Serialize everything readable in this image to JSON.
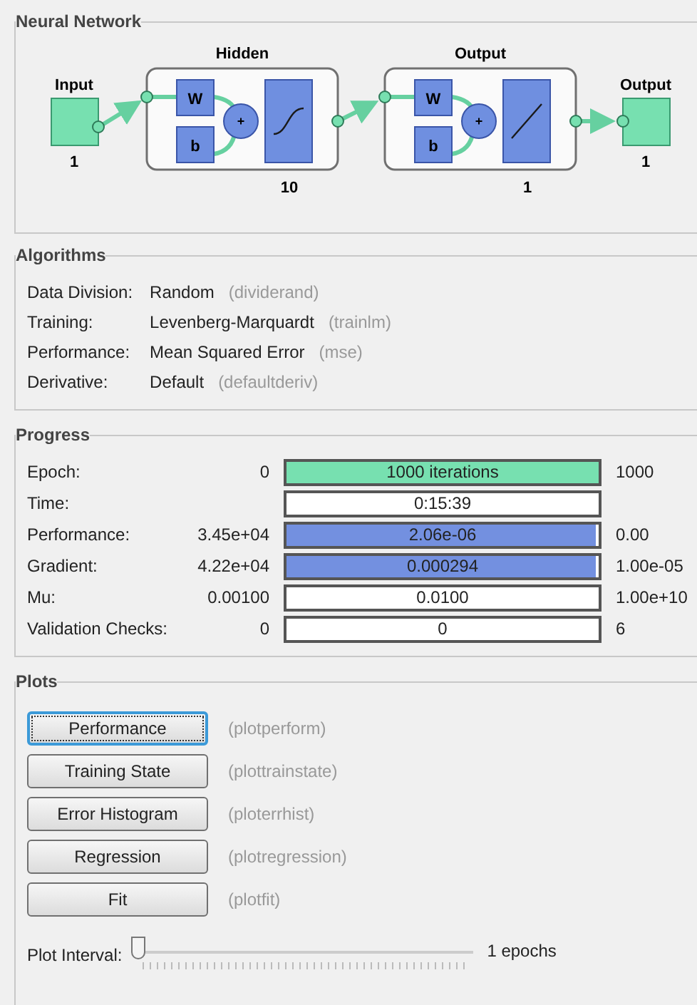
{
  "network": {
    "title": "Neural Network",
    "input": {
      "label": "Input",
      "size": "1"
    },
    "layers": [
      {
        "label": "Hidden",
        "weight": "W",
        "bias": "b",
        "sum": "+",
        "kind": "sigmoid",
        "size": "10"
      },
      {
        "label": "Output",
        "weight": "W",
        "bias": "b",
        "sum": "+",
        "kind": "linear",
        "size": "1"
      }
    ],
    "output": {
      "label": "Output",
      "size": "1"
    }
  },
  "algorithms": {
    "title": "Algorithms",
    "rows": [
      {
        "label": "Data Division:",
        "value": "Random",
        "function": "(dividerand)"
      },
      {
        "label": "Training:",
        "value": "Levenberg-Marquardt",
        "function": "(trainlm)"
      },
      {
        "label": "Performance:",
        "value": "Mean Squared Error",
        "function": "(mse)"
      },
      {
        "label": "Derivative:",
        "value": "Default",
        "function": "(defaultderiv)"
      }
    ]
  },
  "progress": {
    "title": "Progress",
    "rows": [
      {
        "label": "Epoch:",
        "start": "0",
        "reading": "1000 iterations",
        "end": "1000",
        "level": 1,
        "color": "#77e0b0"
      },
      {
        "label": "Time:",
        "reading": "0:15:39"
      },
      {
        "label": "Performance:",
        "start": "3.45e+04",
        "reading": "2.06e-06",
        "end": "0.00",
        "level": 0.99,
        "color": "#7390e0"
      },
      {
        "label": "Gradient:",
        "start": "4.22e+04",
        "reading": "0.000294",
        "end": "1.00e-05",
        "level": 0.99,
        "color": "#7390e0"
      },
      {
        "label": "Mu:",
        "start": "0.00100",
        "reading": "0.0100",
        "end": "1.00e+10"
      },
      {
        "label": "Validation Checks:",
        "start": "0",
        "reading": "0",
        "end": "6"
      }
    ]
  },
  "plots": {
    "title": "Plots",
    "buttons": [
      {
        "label": "Performance",
        "function": "(plotperform)",
        "focused": true
      },
      {
        "label": "Training State",
        "function": "(plottrainstate)",
        "focused": false
      },
      {
        "label": "Error Histogram",
        "function": "(ploterrhist)",
        "focused": false
      },
      {
        "label": "Regression",
        "function": "(plotregression)",
        "focused": false
      },
      {
        "label": "Fit",
        "function": "(plotfit)",
        "focused": false
      }
    ],
    "interval": {
      "label": "Plot Interval:",
      "level": 0,
      "reading": "1 epochs"
    }
  }
}
